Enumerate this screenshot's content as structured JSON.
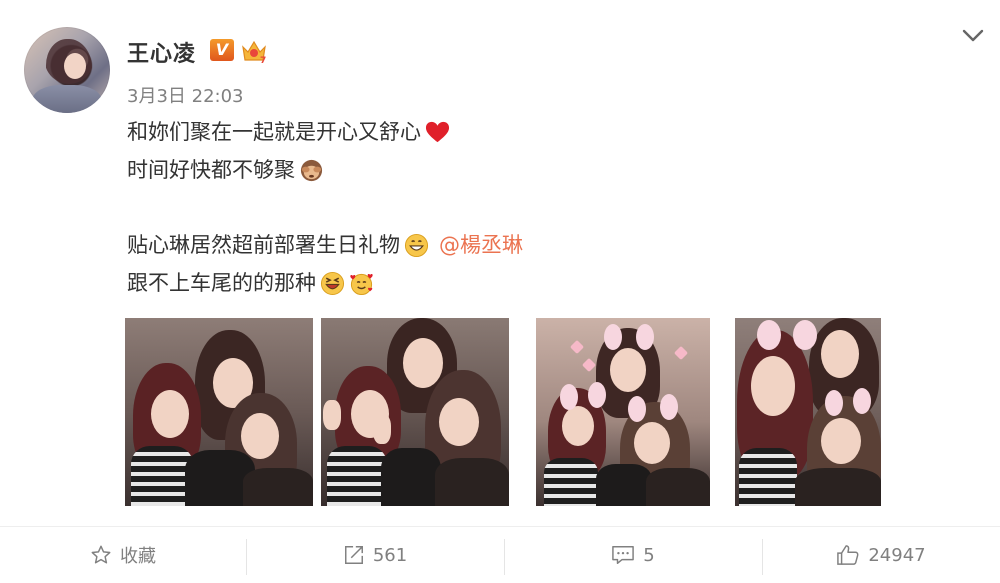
{
  "user": {
    "name": "王心凌",
    "vip_label": "V"
  },
  "post": {
    "time": "3月3日 22:03",
    "lines": [
      "和妳们聚在一起就是开心又舒心",
      "时间好快都不够聚",
      "",
      "贴心琳居然超前部署生日礼物",
      "跟不上车尾的的那种"
    ],
    "mention": "@楊丞琳",
    "emoji": [
      "red-heart",
      "see-no-evil-monkey",
      "grinning-face",
      "laughing-face",
      "smiling-face-with-hearts"
    ]
  },
  "actions": {
    "favorite_label": "收藏",
    "repost_count": "561",
    "comment_count": "5",
    "like_count": "24947"
  },
  "colors": {
    "mention": "#eb7350",
    "text": "#333333",
    "muted": "#808080",
    "badge": "#e0561d"
  }
}
